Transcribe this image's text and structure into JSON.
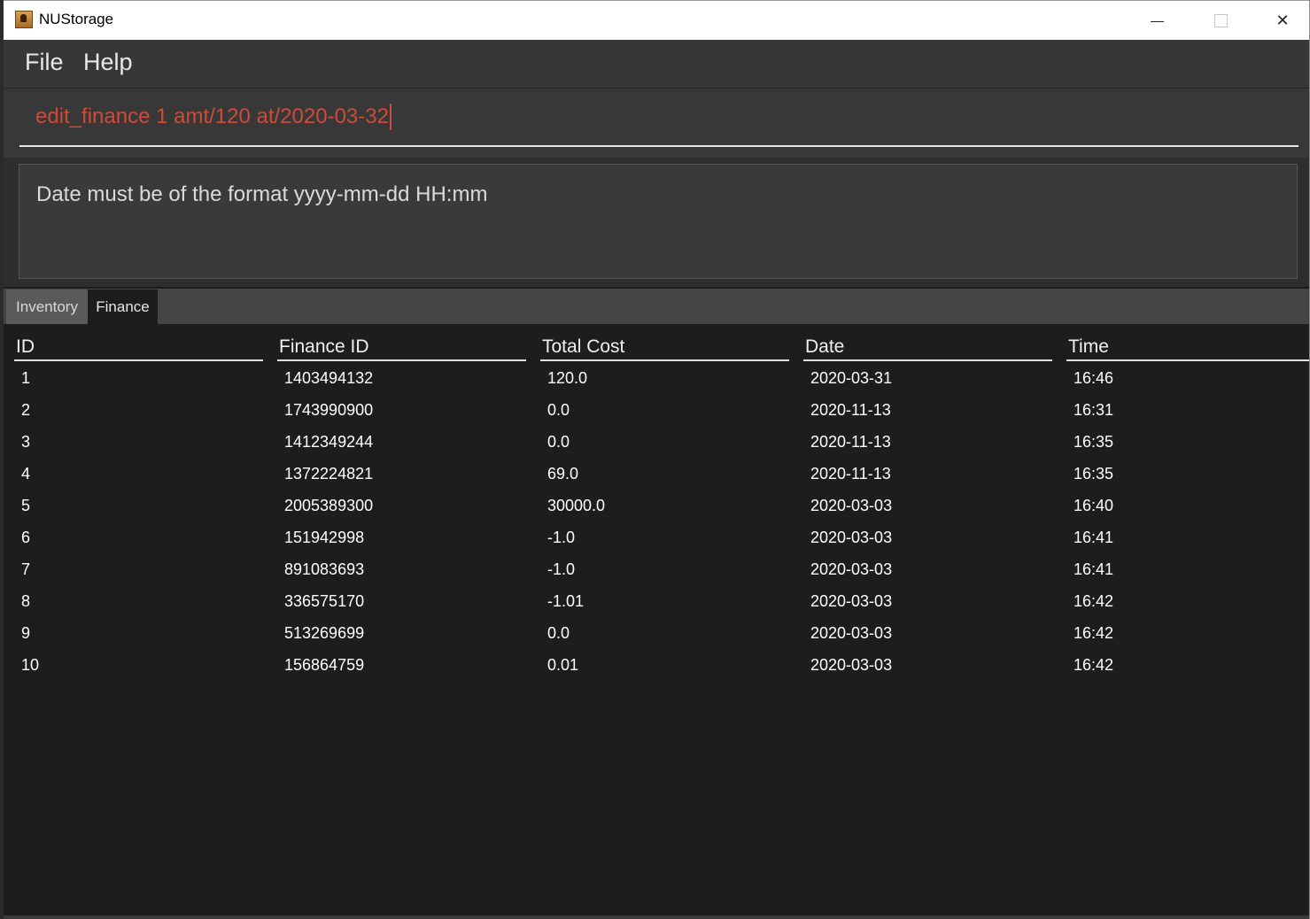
{
  "window": {
    "title": "NUStorage",
    "min_symbol": "—",
    "max_symbol": "☐",
    "close_symbol": "✕"
  },
  "menu": {
    "file": "File",
    "help": "Help"
  },
  "command": {
    "value": "edit_finance 1 amt/120 at/2020-03-32",
    "color": "#cf4b39"
  },
  "result": {
    "message": "Date must be of the format yyyy-mm-dd HH:mm"
  },
  "tabs": [
    {
      "label": "Inventory",
      "selected": false
    },
    {
      "label": "Finance",
      "selected": true
    }
  ],
  "table": {
    "headers": [
      "ID",
      "Finance ID",
      "Total Cost",
      "Date",
      "Time"
    ],
    "rows": [
      [
        "1",
        "1403494132",
        "120.0",
        "2020-03-31",
        "16:46"
      ],
      [
        "2",
        "1743990900",
        "0.0",
        "2020-11-13",
        "16:31"
      ],
      [
        "3",
        "1412349244",
        "0.0",
        "2020-11-13",
        "16:35"
      ],
      [
        "4",
        "1372224821",
        "69.0",
        "2020-11-13",
        "16:35"
      ],
      [
        "5",
        "2005389300",
        "30000.0",
        "2020-03-03",
        "16:40"
      ],
      [
        "6",
        "151942998",
        "-1.0",
        "2020-03-03",
        "16:41"
      ],
      [
        "7",
        "891083693",
        "-1.0",
        "2020-03-03",
        "16:41"
      ],
      [
        "8",
        "336575170",
        "-1.01",
        "2020-03-03",
        "16:42"
      ],
      [
        "9",
        "513269699",
        "0.0",
        "2020-03-03",
        "16:42"
      ],
      [
        "10",
        "156864759",
        "0.01",
        "2020-03-03",
        "16:42"
      ]
    ]
  }
}
